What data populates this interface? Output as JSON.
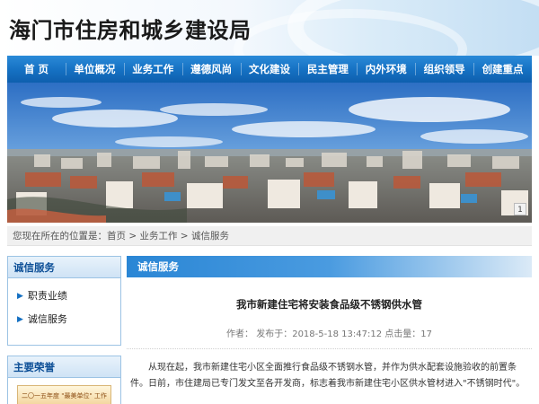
{
  "header": {
    "site_title": "海门市住房和城乡建设局"
  },
  "nav": {
    "items": [
      {
        "label": "首 页"
      },
      {
        "label": "单位概况"
      },
      {
        "label": "业务工作"
      },
      {
        "label": "遵德风尚"
      },
      {
        "label": "文化建设"
      },
      {
        "label": "民主管理"
      },
      {
        "label": "内外环境"
      },
      {
        "label": "组织领导"
      },
      {
        "label": "创建重点"
      }
    ]
  },
  "banner": {
    "page_indicator": "1"
  },
  "breadcrumb": {
    "text": "您现在所在的位置是：首页 > 业务工作 > 诚信服务"
  },
  "sidebar": {
    "box1": {
      "title": "诚信服务",
      "items": [
        {
          "label": "职责业绩"
        },
        {
          "label": "诚信服务"
        }
      ]
    },
    "box2": {
      "title": "主要荣誉",
      "thumb_text": "二〇一五年度 \"最美单位\" 工作"
    }
  },
  "main": {
    "section_title": "诚信服务",
    "article": {
      "title": "我市新建住宅将安装食品级不锈钢供水管",
      "meta": "作者： 发布于：2018-5-18 13:47:12 点击量：17",
      "body": "从现在起，我市新建住宅小区全面推行食品级不锈钢水管，并作为供水配套设施验收的前置条件。日前，市住建局已专门发文至各开发商，标志着我市新建住宅小区供水管材进入\"不锈钢时代\"。"
    }
  },
  "colors": {
    "nav_blue": "#1570c2",
    "accent_blue": "#2a86d5",
    "side_border": "#9cc3e4"
  }
}
